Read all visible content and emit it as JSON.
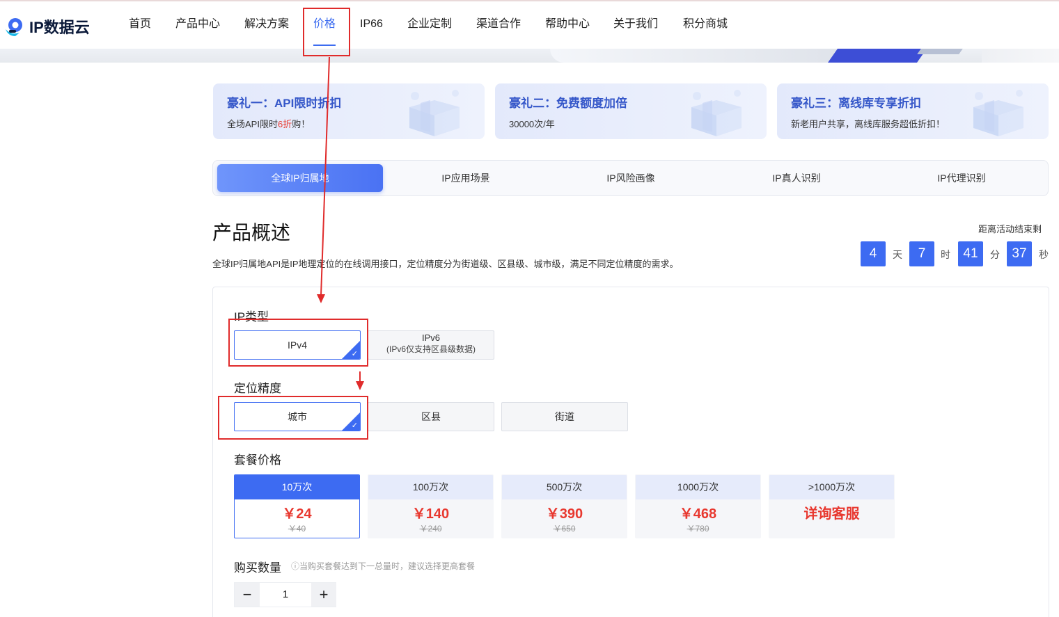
{
  "colors": {
    "accent": "#3d6bf2",
    "price_red": "#e8382f",
    "annotation_red": "#e02b2b"
  },
  "header": {
    "logo_text": "IP数据云",
    "nav": [
      "首页",
      "产品中心",
      "解决方案",
      "价格",
      "IP66",
      "企业定制",
      "渠道合作",
      "帮助中心",
      "关于我们",
      "积分商城"
    ],
    "active_nav": "价格"
  },
  "promos": [
    {
      "title": "豪礼一：API限时折扣",
      "sub_before": "全场API限时",
      "sub_highlight": "6折",
      "sub_after": "购！"
    },
    {
      "title": "豪礼二：免费额度加倍",
      "sub_before": "30000次/年",
      "sub_highlight": "",
      "sub_after": ""
    },
    {
      "title": "豪礼三：离线库专享折扣",
      "sub_before": "新老用户共享，离线库服务超低折扣！",
      "sub_highlight": "",
      "sub_after": ""
    }
  ],
  "tabs": [
    "全球IP归属地",
    "IP应用场景",
    "IP风险画像",
    "IP真人识别",
    "IP代理识别"
  ],
  "active_tab": "全球IP归属地",
  "overview": {
    "title": "产品概述",
    "description": "全球IP归属地API是IP地理定位的在线调用接口，定位精度分为街道级、区县级、城市级，满足不同定位精度的需求。"
  },
  "countdown": {
    "label": "距离活动结束剩",
    "days": "4",
    "days_unit": "天",
    "hours": "7",
    "hours_unit": "时",
    "minutes": "41",
    "minutes_unit": "分",
    "seconds": "37",
    "seconds_unit": "秒"
  },
  "ip_type": {
    "label": "IP类型",
    "options": [
      {
        "line1": "IPv4",
        "line2": ""
      },
      {
        "line1": "IPv6",
        "line2": "(IPv6仅支持区县级数据)"
      }
    ],
    "selected": "IPv4"
  },
  "precision": {
    "label": "定位精度",
    "options": [
      "城市",
      "区县",
      "街道"
    ],
    "selected": "城市"
  },
  "packages": {
    "label": "套餐价格",
    "items": [
      {
        "name": "10万次",
        "price": "￥24",
        "original": "￥40"
      },
      {
        "name": "100万次",
        "price": "￥140",
        "original": "￥240"
      },
      {
        "name": "500万次",
        "price": "￥390",
        "original": "￥650"
      },
      {
        "name": "1000万次",
        "price": "￥468",
        "original": "￥780"
      },
      {
        "name": ">1000万次",
        "price": "详询客服",
        "original": ""
      }
    ],
    "selected": "10万次"
  },
  "quantity": {
    "label": "购买数量",
    "hint": "ⓘ当购买套餐达到下一总量时，建议选择更高套餐",
    "value": "1",
    "minus": "−",
    "plus": "+"
  },
  "icons": [
    "logo-icon",
    "gift-box-icon",
    "check-icon",
    "minus-icon",
    "plus-icon"
  ]
}
